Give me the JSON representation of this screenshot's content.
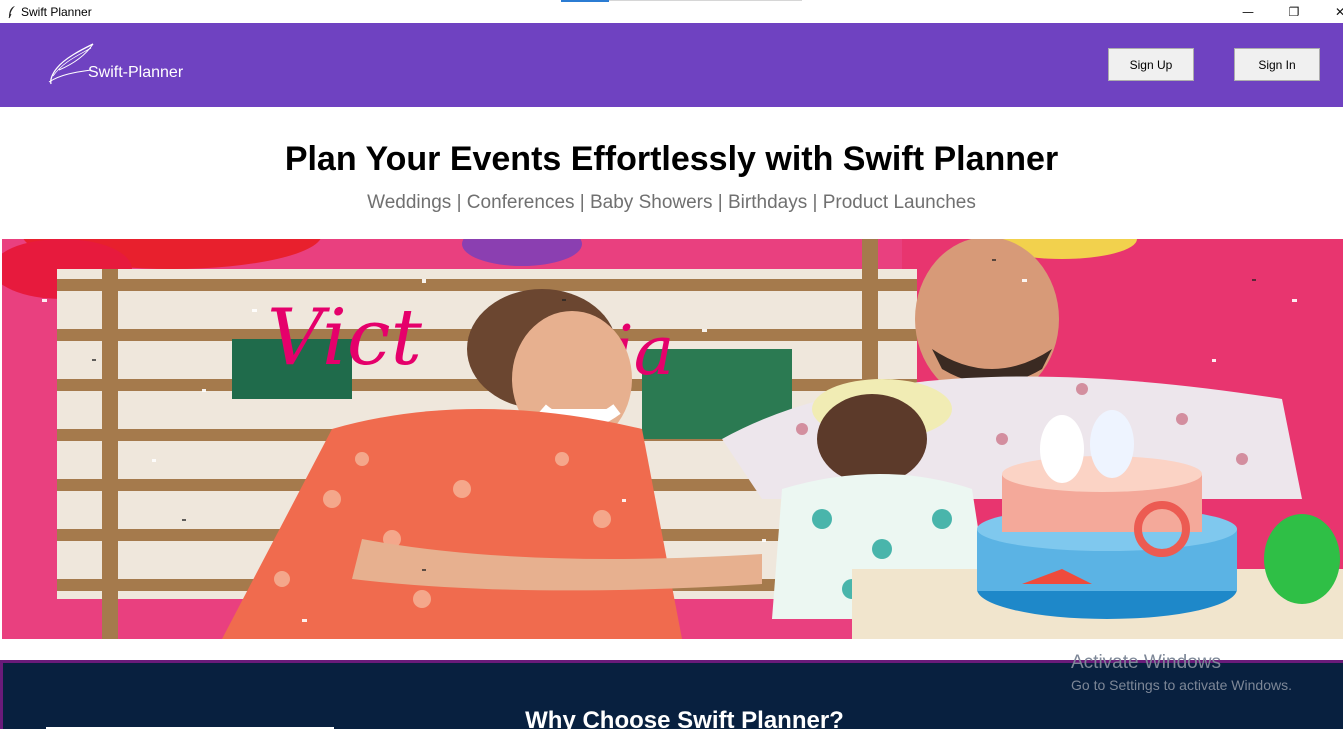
{
  "window": {
    "title": "Swift Planner",
    "controls": {
      "minimize": "—",
      "maximize": "❐",
      "close": "✕"
    }
  },
  "header": {
    "logo_text": "Swift-Planner",
    "sign_up_label": "Sign Up",
    "sign_in_label": "Sign In",
    "background_color": "#6f42c1"
  },
  "hero": {
    "title": "Plan Your Events Effortlessly with Swift Planner",
    "subtitle": "Weddings | Conferences | Baby Showers | Birthdays | Product Launches",
    "image_sign_text": "Victoria"
  },
  "why_section": {
    "title": "Why Choose Swift Planner?",
    "background_color": "#08203f"
  },
  "watermark": {
    "line1": "Activate Windows",
    "line2": "Go to Settings to activate Windows."
  }
}
